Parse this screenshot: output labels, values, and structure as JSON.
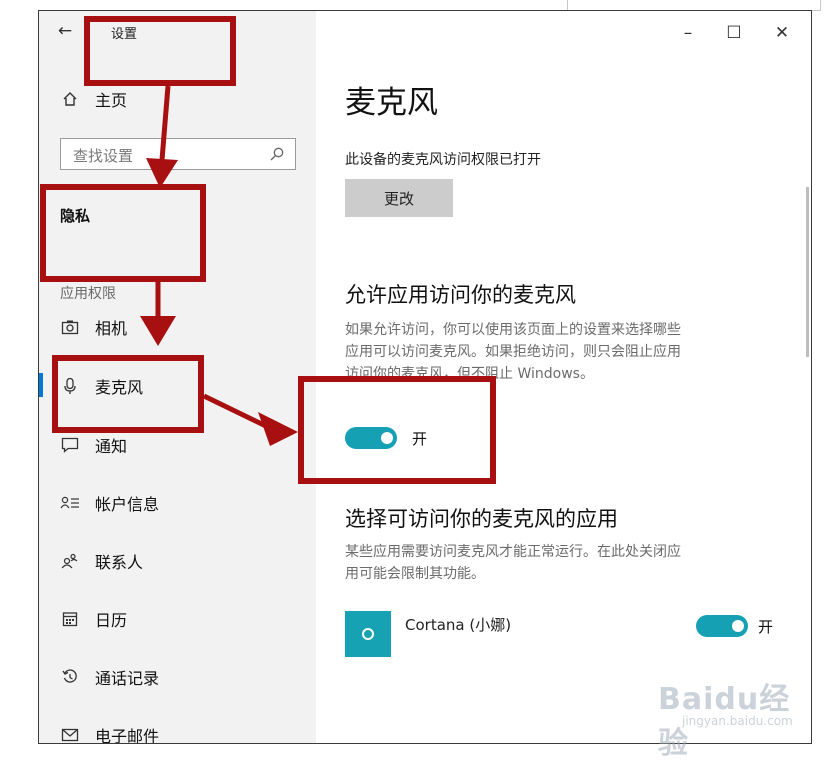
{
  "window": {
    "title": "设置",
    "back_icon": "←",
    "controls": {
      "minimize": "–",
      "maximize": "☐",
      "close": "✕"
    }
  },
  "sidebar": {
    "home": {
      "label": "主页",
      "icon": "home-icon"
    },
    "search": {
      "placeholder": "查找设置",
      "icon": "search-icon"
    },
    "section": "隐私",
    "group_label": "应用权限",
    "items": [
      {
        "label": "相机",
        "icon": "camera-icon"
      },
      {
        "label": "麦克风",
        "icon": "microphone-icon",
        "active": true
      },
      {
        "label": "通知",
        "icon": "notification-icon"
      },
      {
        "label": "帐户信息",
        "icon": "account-info-icon"
      },
      {
        "label": "联系人",
        "icon": "contacts-icon"
      },
      {
        "label": "日历",
        "icon": "calendar-icon"
      },
      {
        "label": "通话记录",
        "icon": "call-history-icon"
      },
      {
        "label": "电子邮件",
        "icon": "email-icon"
      }
    ]
  },
  "main": {
    "title": "麦克风",
    "device_status": "此设备的麦克风访问权限已打开",
    "change_button": "更改",
    "allow_heading": "允许应用访问你的麦克风",
    "allow_desc_1": "如果允许访问，你可以使用该页面上的设置来选择哪些",
    "allow_desc_2": "应用可以访问麦克风。如果拒绝访问，则只会阻止应用",
    "allow_desc_3": "访问你的麦克风，但不阻止 Windows。",
    "allow_toggle": {
      "state": "开",
      "on": true
    },
    "choose_heading": "选择可访问你的麦克风的应用",
    "choose_desc_1": "某些应用需要访问麦克风才能正常运行。在此处关闭应",
    "choose_desc_2": "用可能会限制其功能。",
    "apps": [
      {
        "name": "Cortana (小娜)",
        "toggle_label": "开",
        "on": true
      }
    ]
  },
  "watermark": {
    "text": "Baidu经验",
    "sub": "jingyan.baidu.com"
  },
  "colors": {
    "accent": "#0078d7",
    "toggle_on": "#16a0b4",
    "annotation_red": "#a80f10"
  }
}
